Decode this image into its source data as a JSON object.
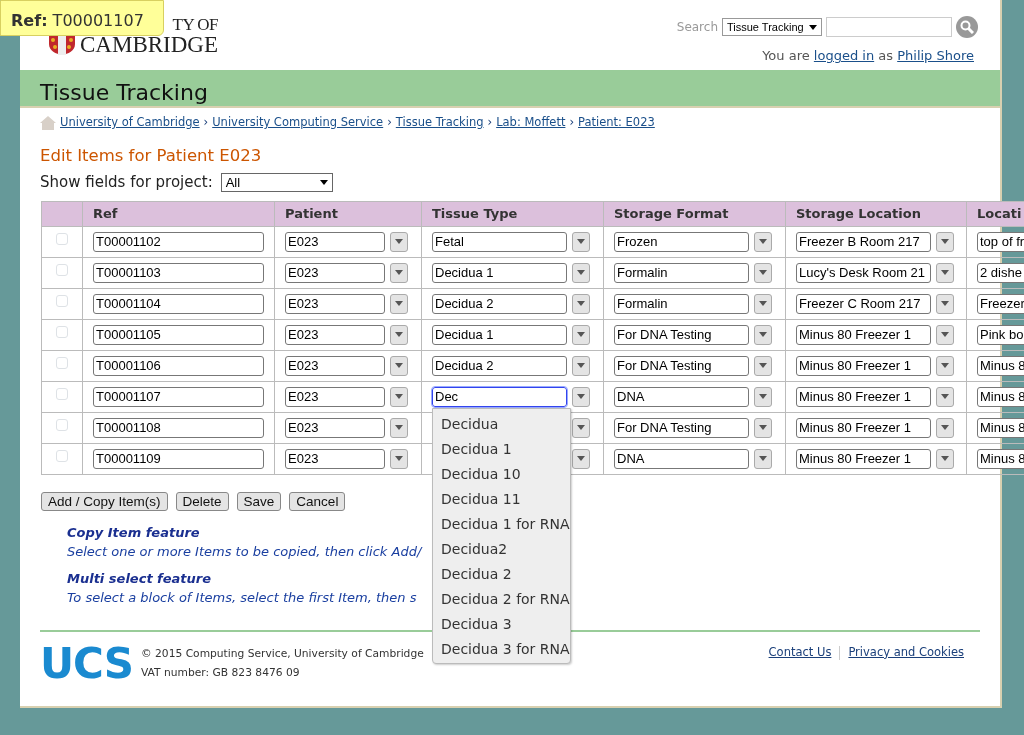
{
  "tooltip": {
    "label": "Ref:",
    "value": "T00001107"
  },
  "logo": {
    "line1": "TY OF",
    "line2": "CAMBRIDGE"
  },
  "search": {
    "label": "Search",
    "scope": "Tissue Tracking"
  },
  "login": {
    "before": "You are",
    "link": "logged in",
    "middle": "as",
    "user": "Philip Shore"
  },
  "app_title": "Tissue Tracking",
  "breadcrumbs": [
    {
      "label": "University of Cambridge"
    },
    {
      "separator": "›",
      "label": "University Computing Service"
    },
    {
      "separator": "›",
      "label": "Tissue Tracking"
    },
    {
      "separator": "›",
      "label": "Lab: Moffett"
    },
    {
      "separator": "›",
      "label": "Patient: E023"
    }
  ],
  "heading": "Edit Items for Patient E023",
  "project_filter": {
    "label": "Show fields for project:",
    "value": "All"
  },
  "table": {
    "columns": [
      "Ref",
      "Patient",
      "Tissue Type",
      "Storage Format",
      "Storage Location",
      "Locati"
    ],
    "rows": [
      {
        "checked": false,
        "focused": false,
        "ref": "T00001102",
        "patient": "E023",
        "tissue_type": "Fetal",
        "storage_format": "Frozen",
        "storage_location": "Freezer B Room 217",
        "location": "top of fr"
      },
      {
        "checked": false,
        "focused": false,
        "ref": "T00001103",
        "patient": "E023",
        "tissue_type": "Decidua 1",
        "storage_format": "Formalin",
        "storage_location": "Lucy's Desk Room 21",
        "location": "2 dishe"
      },
      {
        "checked": false,
        "focused": false,
        "ref": "T00001104",
        "patient": "E023",
        "tissue_type": "Decidua 2",
        "storage_format": "Formalin",
        "storage_location": "Freezer C Room 217",
        "location": "Freezer"
      },
      {
        "checked": false,
        "focused": false,
        "ref": "T00001105",
        "patient": "E023",
        "tissue_type": "Decidua 1",
        "storage_format": "For DNA Testing",
        "storage_location": "Minus 80 Freezer 1",
        "location": "Pink bo"
      },
      {
        "checked": false,
        "focused": false,
        "ref": "T00001106",
        "patient": "E023",
        "tissue_type": "Decidua 2",
        "storage_format": "For DNA Testing",
        "storage_location": "Minus 80 Freezer 1",
        "location": "Minus 8"
      },
      {
        "checked": false,
        "focused": true,
        "ref": "T00001107",
        "patient": "E023",
        "tissue_type": "Dec",
        "storage_format": "DNA",
        "storage_location": "Minus 80 Freezer 1",
        "location": "Minus 8"
      },
      {
        "checked": false,
        "ref": "T00001108",
        "patient": "E023",
        "storage_format": "For DNA Testing",
        "storage_location": "Minus 80 Freezer 1",
        "location": "Minus 8"
      },
      {
        "checked": false,
        "ref": "T00001109",
        "patient": "E023",
        "storage_format": "DNA",
        "storage_location": "Minus 80 Freezer 1",
        "location": "Minus 8"
      }
    ]
  },
  "autocomplete": {
    "options": [
      "Decidua",
      "Decidua 1",
      "Decidua 10",
      "Decidua 11",
      "Decidua 1 for RNA",
      "Decidua2",
      "Decidua 2",
      "Decidua 2 for RNA",
      "Decidua 3",
      "Decidua 3 for RNA"
    ]
  },
  "buttons": [
    "Add / Copy Item(s)",
    "Delete",
    "Save",
    "Cancel"
  ],
  "help": [
    {
      "title": "Copy Item feature",
      "text": "Select one or more Items to be copied, then click Add/"
    },
    {
      "title": "Multi select feature",
      "text": "To select a block of Items, select the first Item, then s"
    }
  ],
  "footer": {
    "logo": "UCS",
    "copyright": "© 2015 Computing Service, University of Cambridge",
    "vat": "VAT number: GB 823 8476 09",
    "links": [
      "Contact Us",
      "Privacy and Cookies"
    ]
  }
}
